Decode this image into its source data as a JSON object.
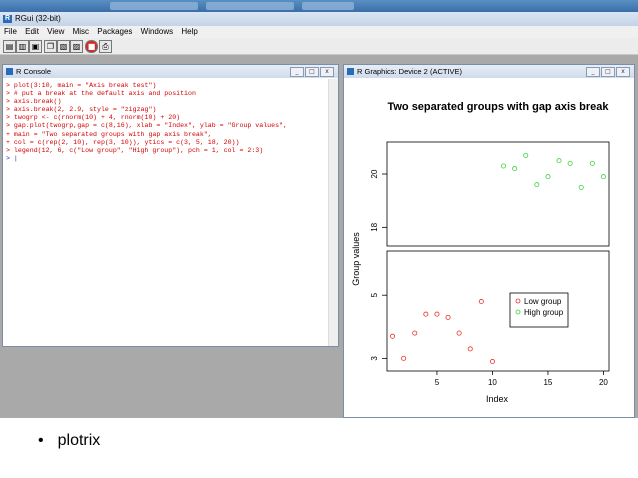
{
  "app": {
    "title": "RGui (32-bit)"
  },
  "menu": [
    "File",
    "Edit",
    "View",
    "Misc",
    "Packages",
    "Windows",
    "Help"
  ],
  "toolbar_icons": [
    "open-script-icon",
    "load-workspace-icon",
    "save-workspace-icon",
    "copy-icon",
    "paste-icon",
    "copy-paste-icon",
    "stop-icon",
    "print-icon"
  ],
  "console": {
    "title": "R Console",
    "lines": [
      "> plot(3:10, main = \"Axis break test\")",
      "> # put a break at the default axis and position",
      "> axis.break()",
      "> axis.break(2, 2.9, style = \"zigzag\")",
      "> twogrp <- c(rnorm(10) + 4, rnorm(10) + 20)",
      "> gap.plot(twogrp,gap = c(8,16), xlab = \"Index\", ylab = \"Group values\",",
      "+ main = \"Two separated groups with gap axis break\",",
      "+ col = c(rep(2, 10), rep(3, 10)), ytics = c(3, 5, 18, 20))",
      "> legend(12, 6, c(\"Low group\", \"High group\"), pch = 1, col = 2:3)",
      "> |"
    ]
  },
  "graphics": {
    "title": "R Graphics: Device 2 (ACTIVE)"
  },
  "window_buttons": {
    "minimize": "_",
    "maximize": "□",
    "close": "x"
  },
  "chart_data": {
    "type": "scatter",
    "title": "Two separated groups with gap axis break",
    "xlabel": "Index",
    "ylabel": "Group values",
    "xlim": [
      0.5,
      20.5
    ],
    "x_ticks": [
      5,
      10,
      15,
      20
    ],
    "lower_panel": {
      "ylim": [
        2.6,
        6.4
      ],
      "y_ticks": [
        3,
        5
      ]
    },
    "upper_panel": {
      "ylim": [
        17.3,
        21.2
      ],
      "y_ticks": [
        18,
        20
      ]
    },
    "legend": {
      "placement": "inside-right-lower-panel"
    },
    "series": [
      {
        "name": "Low group",
        "color": "#e8332a",
        "x": [
          1,
          2,
          3,
          4,
          5,
          6,
          7,
          8,
          9,
          10
        ],
        "y": [
          3.7,
          3.0,
          3.8,
          4.4,
          4.4,
          4.3,
          3.8,
          3.3,
          4.8,
          2.9
        ]
      },
      {
        "name": "High group",
        "color": "#3fd13f",
        "x": [
          11,
          12,
          13,
          14,
          15,
          16,
          17,
          18,
          19,
          20
        ],
        "y": [
          20.3,
          20.2,
          20.7,
          19.6,
          19.9,
          20.5,
          20.4,
          19.5,
          20.4,
          19.9
        ]
      }
    ]
  },
  "slide": {
    "bullet": "•",
    "text": "plotrix"
  }
}
